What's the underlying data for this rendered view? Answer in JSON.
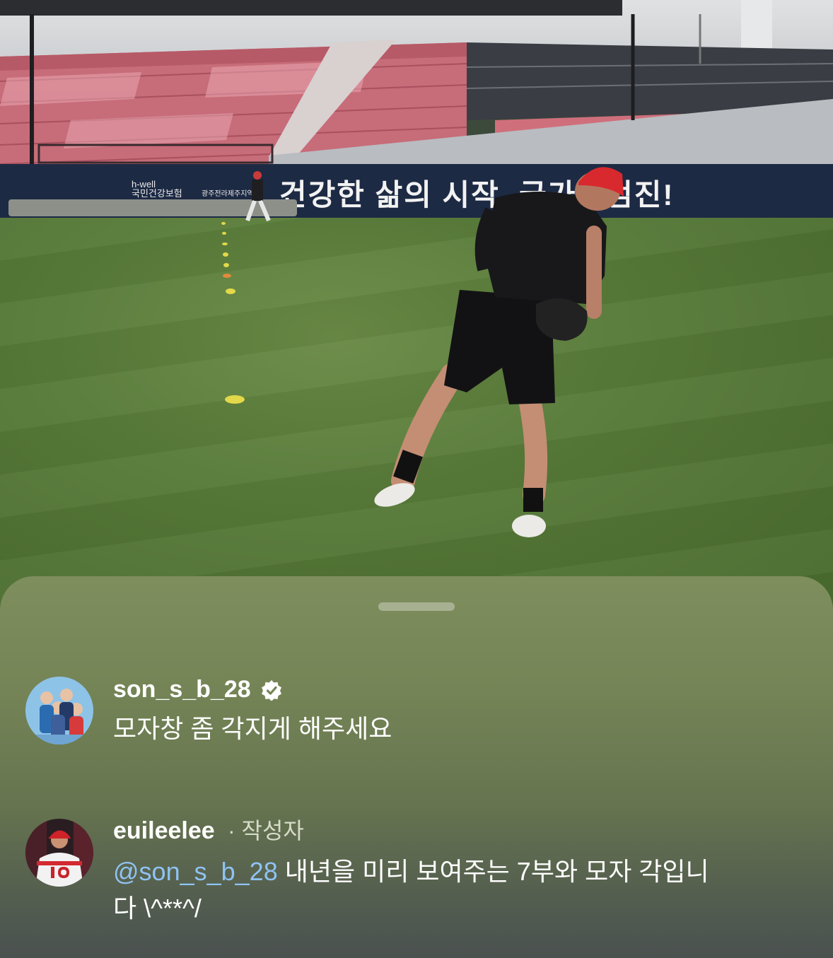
{
  "scene": {
    "banner_main": "건강한 삶의 시작, 국가암검진!",
    "banner_brand_line1": "h-well",
    "banner_brand_line2": "국민건강보험",
    "banner_region": "광주전라제주지역"
  },
  "comments": [
    {
      "username": "son_s_b_28",
      "verified": true,
      "avatar": "group-illustration-avatar",
      "text": "모자창 좀 각지게 해주세요"
    },
    {
      "username": "euileelee",
      "meta": "· 작성자",
      "avatar": "baseball-player-avatar",
      "mention": "@son_s_b_28",
      "text_line1": " 내년을 미리 보여주는 7부와 모자 각입니",
      "text_line2": "다 \\^**^/"
    }
  ],
  "icons": {
    "verified": "verified-badge-icon",
    "grabber": "sheet-grabber"
  },
  "colors": {
    "mention": "#8fc3f2",
    "sheet_top": "#7f8e5d",
    "sheet_bottom": "#4a5150"
  }
}
